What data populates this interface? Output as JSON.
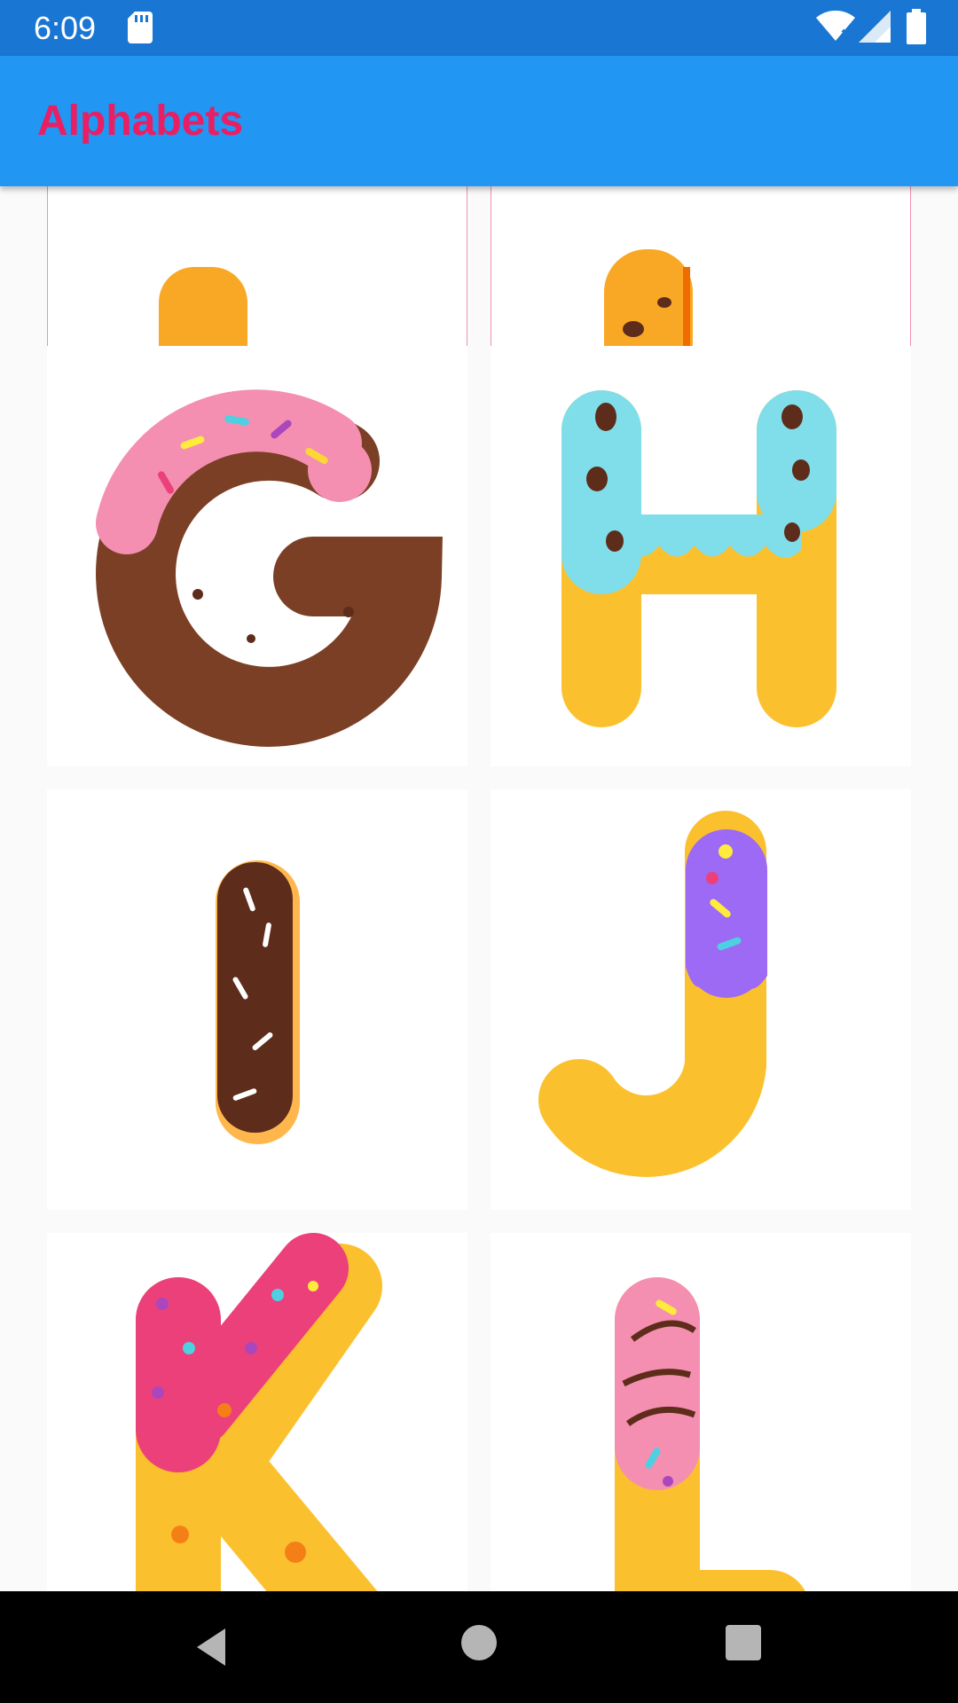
{
  "status_bar": {
    "time": "6:09",
    "icons": [
      "sd-card-icon",
      "wifi-icon",
      "signal-icon",
      "battery-icon"
    ]
  },
  "app_bar": {
    "title": "Alphabets",
    "background": "#2196f3",
    "title_color": "#e91e63"
  },
  "grid": {
    "tiles": [
      {
        "letter": "E",
        "style": "orange sponge",
        "selected": true
      },
      {
        "letter": "F",
        "style": "orange with chocolate chips",
        "selected": true
      },
      {
        "letter": "G",
        "style": "chocolate donut with pink icing"
      },
      {
        "letter": "H",
        "style": "waffle with blue icing"
      },
      {
        "letter": "I",
        "style": "chocolate eclair"
      },
      {
        "letter": "J",
        "style": "waffle with purple icing"
      },
      {
        "letter": "K",
        "style": "sponge with pink icing"
      },
      {
        "letter": "L",
        "style": "waffle with pink icing"
      }
    ]
  },
  "nav_bar": {
    "buttons": [
      "back-icon",
      "home-icon",
      "recent-apps-icon"
    ]
  }
}
